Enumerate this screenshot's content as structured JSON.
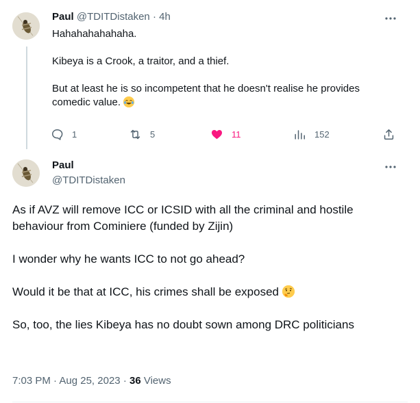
{
  "tweet1": {
    "name": "Paul",
    "handle": "@TDITDistaken",
    "separator": "·",
    "time": "4h",
    "more_label": "···",
    "paragraphs": [
      "Hahahahahahaha.",
      "Kibeya is a Crook, a traitor, and a thief.",
      "But at least he is so incompetent that he doesn't realise he provides comedic value."
    ],
    "end_emoji": "face-with-tears-of-joy",
    "actions": {
      "replies": "1",
      "reposts": "5",
      "likes": "11",
      "views": "152"
    }
  },
  "tweet2": {
    "name": "Paul",
    "handle": "@TDITDistaken",
    "more_label": "···",
    "paragraphs": [
      "As if AVZ will remove ICC or ICSID with all the criminal and hostile behaviour from Cominiere (funded by Zijin)",
      "I wonder why he wants ICC to not go ahead?",
      "Would it be that at ICC, his crimes shall be exposed",
      "So, too, the lies Kibeya has no doubt sown among DRC politicians"
    ],
    "thinking_emoji": "thinking-face",
    "meta": {
      "time": "7:03 PM",
      "sep1": "·",
      "date": "Aug 25, 2023",
      "sep2": "·",
      "views_count": "36",
      "views_label": "Views"
    }
  },
  "colors": {
    "text": "#0f1419",
    "muted": "#536471",
    "like": "#f91880",
    "thread_line": "#cfd9de"
  }
}
